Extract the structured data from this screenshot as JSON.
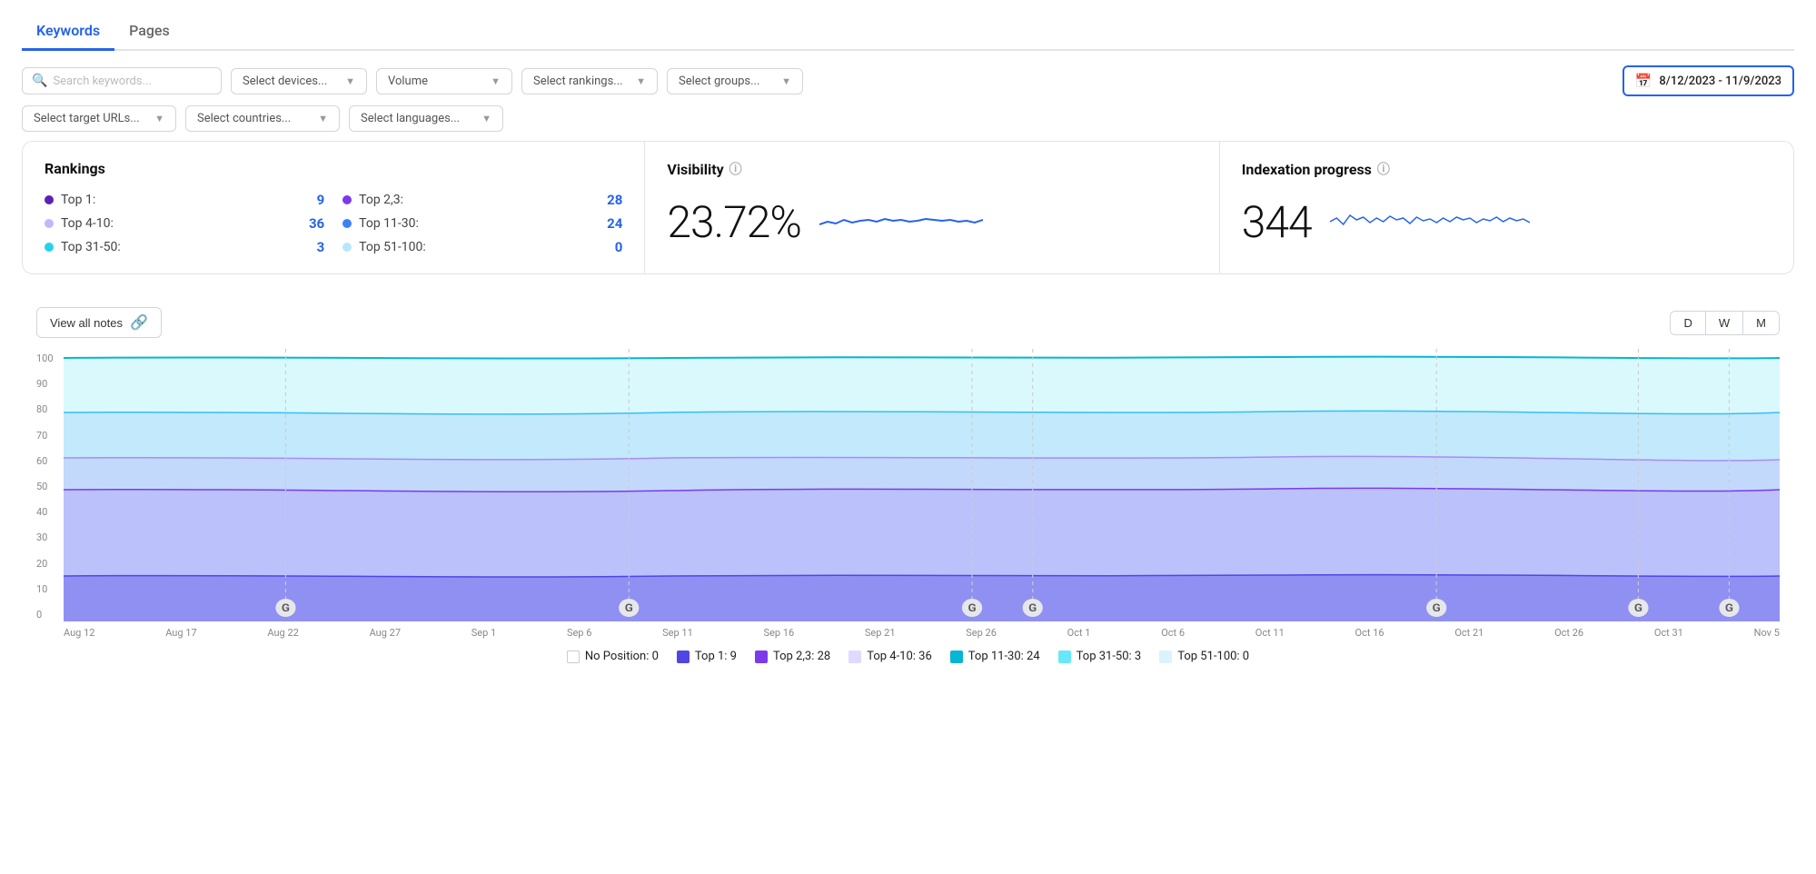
{
  "tabs": [
    {
      "id": "keywords",
      "label": "Keywords",
      "active": true
    },
    {
      "id": "pages",
      "label": "Pages",
      "active": false
    }
  ],
  "filters": {
    "search_placeholder": "Search keywords...",
    "devices_label": "Select devices...",
    "volume_label": "Volume",
    "rankings_label": "Select rankings...",
    "groups_label": "Select groups...",
    "target_urls_label": "Select target URLs...",
    "countries_label": "Select countries...",
    "languages_label": "Select languages...",
    "date_range": "8/12/2023 - 11/9/2023"
  },
  "rankings": {
    "title": "Rankings",
    "items": [
      {
        "label": "Top 1:",
        "count": "9",
        "dot": "dark-purple"
      },
      {
        "label": "Top 2,3:",
        "count": "28",
        "dot": "purple"
      },
      {
        "label": "Top 4-10:",
        "count": "36",
        "dot": "light-purple"
      },
      {
        "label": "Top 11-30:",
        "count": "24",
        "dot": "blue"
      },
      {
        "label": "Top 31-50:",
        "count": "3",
        "dot": "teal"
      },
      {
        "label": "Top 51-100:",
        "count": "0",
        "dot": "light-blue"
      }
    ]
  },
  "visibility": {
    "title": "Visibility",
    "value": "23.72%"
  },
  "indexation": {
    "title": "Indexation progress",
    "value": "344"
  },
  "chart": {
    "view_notes_label": "View all notes",
    "period_buttons": [
      "D",
      "W",
      "M"
    ],
    "y_labels": [
      "100",
      "90",
      "80",
      "70",
      "60",
      "50",
      "40",
      "30",
      "20",
      "10",
      "0"
    ],
    "x_labels": [
      "Aug 12",
      "Aug 17",
      "Aug 22",
      "Aug 27",
      "Sep 1",
      "Sep 6",
      "Sep 11",
      "Sep 16",
      "Sep 21",
      "Sep 26",
      "Oct 1",
      "Oct 6",
      "Oct 11",
      "Oct 16",
      "Oct 21",
      "Oct 26",
      "Oct 31",
      "Nov 5"
    ]
  },
  "legend": [
    {
      "label": "No Position: 0",
      "color": "transparent",
      "checked": false
    },
    {
      "label": "Top 1: 9",
      "color": "#4f46e5",
      "checked": true
    },
    {
      "label": "Top 2,3: 28",
      "color": "#7c3aed",
      "checked": true
    },
    {
      "label": "Top 4-10: 36",
      "color": "#c4b5fd",
      "checked": false
    },
    {
      "label": "Top 11-30: 24",
      "color": "#06b6d4",
      "checked": true
    },
    {
      "label": "Top 31-50: 3",
      "color": "#67e8f9",
      "checked": true
    },
    {
      "label": "Top 51-100: 0",
      "color": "#bae6fd",
      "checked": false
    }
  ]
}
